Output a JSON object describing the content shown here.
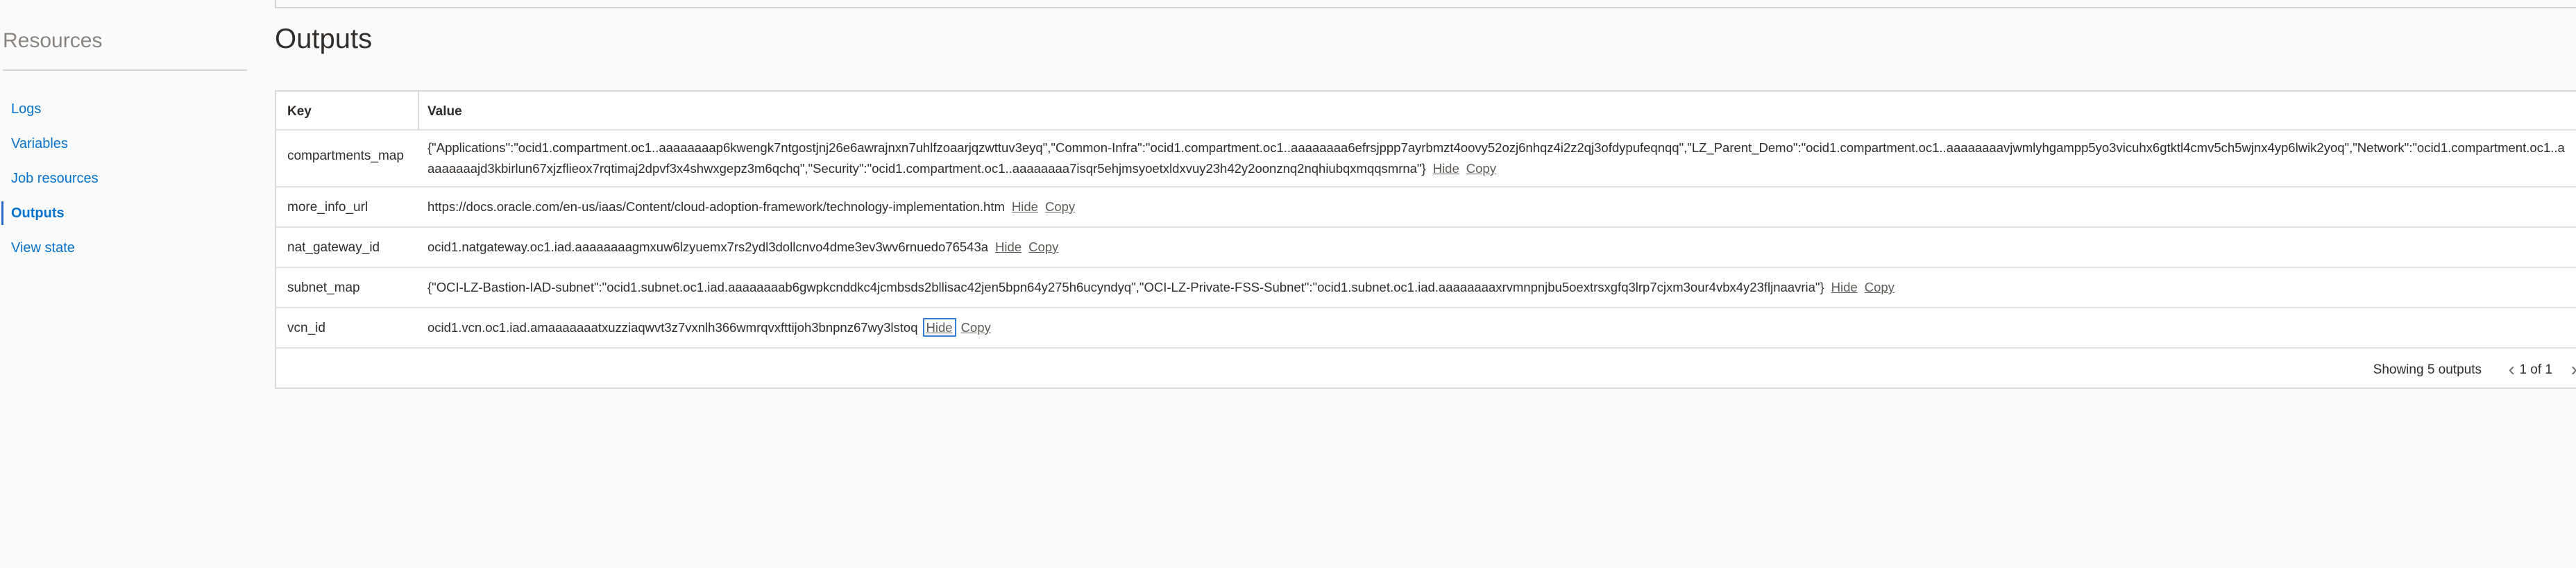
{
  "sidebar": {
    "title": "Resources",
    "items": [
      {
        "label": "Logs"
      },
      {
        "label": "Variables"
      },
      {
        "label": "Job resources"
      },
      {
        "label": "Outputs"
      },
      {
        "label": "View state"
      }
    ],
    "active_index": 3
  },
  "page": {
    "title": "Outputs"
  },
  "table": {
    "headers": {
      "key": "Key",
      "value": "Value"
    },
    "rows": [
      {
        "key": "compartments_map",
        "value": "{\"Applications\":\"ocid1.compartment.oc1..aaaaaaaap6kwengk7ntgostjnj26e6awrajnxn7uhlfzoaarjqzwttuv3eyq\",\"Common-Infra\":\"ocid1.compartment.oc1..aaaaaaaa6efrsjppp7ayrbmzt4oovy52ozj6nhqz4i2z2qj3ofdypufeqnqq\",\"LZ_Parent_Demo\":\"ocid1.compartment.oc1..aaaaaaaavjwmlyhgampp5yo3vicuhx6gtktl4cmv5ch5wjnx4yp6lwik2yoq\",\"Network\":\"ocid1.compartment.oc1..aaaaaaaajd3kbirlun67xjzflieox7rqtimaj2dpvf3x4shwxgepz3m6qchq\",\"Security\":\"ocid1.compartment.oc1..aaaaaaaa7isqr5ehjmsyoetxldxvuy23h42y2oonznq2nqhiubqxmqqsmrna\"}",
        "hide": "Hide",
        "copy": "Copy"
      },
      {
        "key": "more_info_url",
        "value": "https://docs.oracle.com/en-us/iaas/Content/cloud-adoption-framework/technology-implementation.htm",
        "hide": "Hide",
        "copy": "Copy"
      },
      {
        "key": "nat_gateway_id",
        "value": "ocid1.natgateway.oc1.iad.aaaaaaaagmxuw6lzyuemx7rs2ydl3dollcnvo4dme3ev3wv6rnuedo76543a",
        "hide": "Hide",
        "copy": "Copy"
      },
      {
        "key": "subnet_map",
        "value": "{\"OCI-LZ-Bastion-IAD-subnet\":\"ocid1.subnet.oc1.iad.aaaaaaaab6gwpkcnddkc4jcmbsds2bllisac42jen5bpn64y275h6ucyndyq\",\"OCI-LZ-Private-FSS-Subnet\":\"ocid1.subnet.oc1.iad.aaaaaaaaxrvmnpnjbu5oextrsxgfq3lrp7cjxm3our4vbx4y23fljnaavria\"}",
        "hide": "Hide",
        "copy": "Copy"
      },
      {
        "key": "vcn_id",
        "value": "ocid1.vcn.oc1.iad.amaaaaaaatxuzziaqwvt3z7vxnlh366wmrqvxfttijoh3bnpnz67wy3lstoq",
        "hide": "Hide",
        "copy": "Copy"
      }
    ]
  },
  "footer": {
    "showing": "Showing 5 outputs",
    "page": "1 of 1",
    "prev_icon": "chevron-left-icon",
    "next_icon": "chevron-right-icon"
  },
  "colors": {
    "link": "#0572ce",
    "text": "#312d2a",
    "active_marker": "#2a6ac8"
  }
}
